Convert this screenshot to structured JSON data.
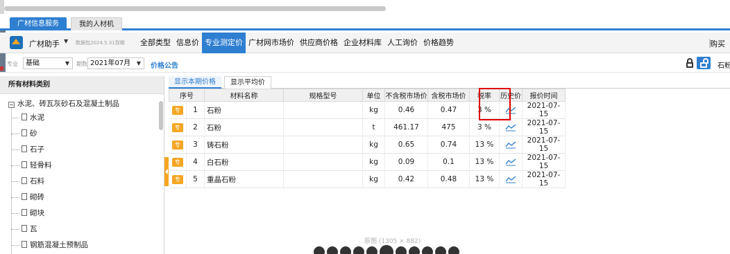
{
  "tabs": [
    {
      "label": "广材信息服务",
      "active": true
    },
    {
      "label": "我的人材机",
      "active": false
    }
  ],
  "toolbar": {
    "app_name": "广材助手",
    "version_note": "数据包2024.5.31到期",
    "nav": [
      {
        "label": "全部类型",
        "active": false
      },
      {
        "label": "信息价",
        "active": false
      },
      {
        "label": "专业测定价",
        "active": true
      },
      {
        "label": "广材网市场价",
        "active": false
      },
      {
        "label": "供应商价格",
        "active": false
      },
      {
        "label": "企业材料库",
        "active": false
      },
      {
        "label": "人工询价",
        "active": false
      },
      {
        "label": "价格趋势",
        "active": false
      }
    ],
    "right_text": "购买"
  },
  "filters": {
    "major_label": "专业",
    "major_value": "基础",
    "period_label": "期数",
    "period_value": "2021年07月",
    "notice_label": "价格公告",
    "right_text": "石粉"
  },
  "sidebar": {
    "title": "所有材料类别",
    "root": "水泥、砖瓦灰砂石及混凝土制品",
    "items": [
      "水泥",
      "砂",
      "石子",
      "轻骨料",
      "石料",
      "砌砖",
      "砌块",
      "瓦",
      "钢筋混凝土预制品"
    ]
  },
  "subtabs": [
    "显示本期价格",
    "显示平均价"
  ],
  "table": {
    "columns": [
      "序号",
      "材料名称",
      "规格型号",
      "单位",
      "不含税市场价",
      "含税市场价",
      "税率",
      "历史价",
      "报价时间"
    ],
    "badge": "专",
    "rows": [
      {
        "no": "1",
        "name": "石粉",
        "spec": "",
        "unit": "kg",
        "price_ex": "0.46",
        "price_in": "0.47",
        "tax": "3 %",
        "date": "2021-07-15"
      },
      {
        "no": "2",
        "name": "石粉",
        "spec": "",
        "unit": "t",
        "price_ex": "461.17",
        "price_in": "475",
        "tax": "3 %",
        "date": "2021-07-15"
      },
      {
        "no": "3",
        "name": "铸石粉",
        "spec": "",
        "unit": "kg",
        "price_ex": "0.65",
        "price_in": "0.74",
        "tax": "13 %",
        "date": "2021-07-15"
      },
      {
        "no": "4",
        "name": "白石粉",
        "spec": "",
        "unit": "kg",
        "price_ex": "0.09",
        "price_in": "0.1",
        "tax": "13 %",
        "date": "2021-07-15"
      },
      {
        "no": "5",
        "name": "重晶石粉",
        "spec": "",
        "unit": "kg",
        "price_ex": "0.42",
        "price_in": "0.48",
        "tax": "13 %",
        "date": "2021-07-15"
      }
    ]
  },
  "viewer": {
    "size_text": "原图 (1305 × 882)"
  },
  "colors": {
    "accent": "#2f7fd1",
    "badge": "#f5a623",
    "highlight": "#e00000"
  }
}
